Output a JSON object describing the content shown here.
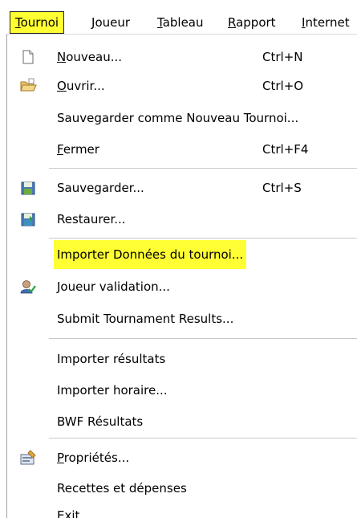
{
  "menubar": {
    "items": [
      {
        "label": "Tournoi",
        "active": true
      },
      {
        "label": "Joueur"
      },
      {
        "label": "Tableau"
      },
      {
        "label": "Rapport"
      },
      {
        "label": "Internet"
      }
    ]
  },
  "menu": {
    "new": {
      "label": "Nouveau...",
      "shortcut": "Ctrl+N",
      "icon": "new-document-icon"
    },
    "open": {
      "label": "Ouvrir...",
      "shortcut": "Ctrl+O",
      "icon": "open-folder-icon"
    },
    "save_as_new": {
      "label": "Sauvegarder comme Nouveau Tournoi..."
    },
    "close": {
      "label": "Fermer",
      "shortcut": "Ctrl+F4"
    },
    "save": {
      "label": "Sauvegarder...",
      "shortcut": "Ctrl+S",
      "icon": "save-disk-icon"
    },
    "restore": {
      "label": "Restaurer...",
      "icon": "restore-disk-icon"
    },
    "import_tournament": {
      "label": "Importer Données du tournoi...",
      "highlighted": true
    },
    "player_validation": {
      "label": "Joueur validation...",
      "icon": "user-check-icon"
    },
    "submit_results": {
      "label": "Submit Tournament Results..."
    },
    "import_results": {
      "label": "Importer résultats"
    },
    "import_schedule": {
      "label": "Importer horaire..."
    },
    "bwf_results": {
      "label": "BWF Résultats"
    },
    "properties": {
      "label": "Propriétés...",
      "icon": "properties-icon"
    },
    "income_expenses": {
      "label": "Recettes et dépenses"
    },
    "exit": {
      "label": "Exit"
    }
  },
  "colors": {
    "highlight": "#ffff33",
    "separator": "#c8c8c8"
  }
}
